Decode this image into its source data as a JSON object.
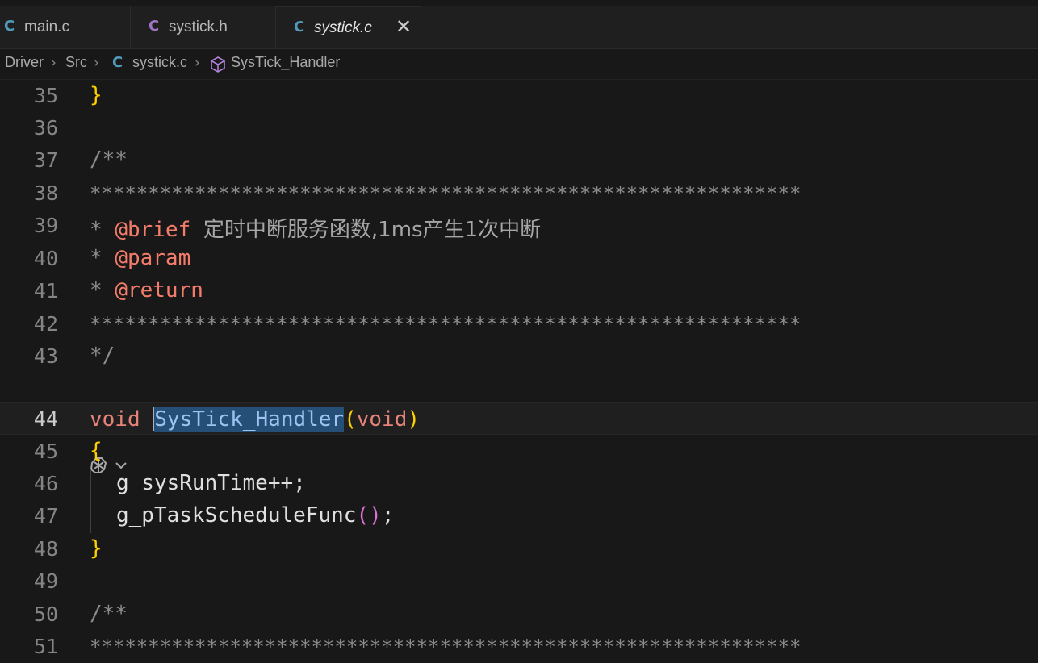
{
  "tabs": [
    {
      "icon": "C",
      "label": "main.c",
      "color": "#519aba",
      "active": false
    },
    {
      "icon": "C",
      "label": "systick.h",
      "color": "#a074c4",
      "active": false
    },
    {
      "icon": "C",
      "label": "systick.c",
      "color": "#519aba",
      "active": true
    }
  ],
  "breadcrumb": {
    "folder1": "Driver",
    "folder2": "Src",
    "file_icon": "C",
    "file": "systick.c",
    "symbol": "SysTick_Handler"
  },
  "editor": {
    "lines": [
      {
        "num": "35",
        "text": "}"
      },
      {
        "num": "36",
        "text": ""
      },
      {
        "num": "37",
        "text": "/**"
      },
      {
        "num": "38",
        "text": "*************************************************************"
      },
      {
        "num": "39",
        "tag": "@brief",
        "desc": "定时中断服务函数,1ms产生1次中断"
      },
      {
        "num": "40",
        "tag": "@param"
      },
      {
        "num": "41",
        "tag": "@return"
      },
      {
        "num": "42",
        "text": "*************************************************************"
      },
      {
        "num": "43",
        "text": "*/"
      },
      {
        "num": "44",
        "kw": "void",
        "fn": "SysTick_Handler",
        "arg": "void"
      },
      {
        "num": "45",
        "text": "{"
      },
      {
        "num": "46",
        "text": "g_sysRunTime++;"
      },
      {
        "num": "47",
        "text": "g_pTaskScheduleFunc"
      },
      {
        "num": "48",
        "text": "}"
      },
      {
        "num": "49",
        "text": ""
      },
      {
        "num": "50",
        "text": "/**"
      },
      {
        "num": "51",
        "text": "*************************************************************"
      }
    ]
  },
  "colors": {
    "background": "#181818",
    "comment": "#8c8c8c",
    "doc_tag": "#f47c6a",
    "keyword": "#e8837a",
    "bracket_gold": "#ffd000",
    "bracket_purple": "#da70d6",
    "selection": "#264f78"
  }
}
